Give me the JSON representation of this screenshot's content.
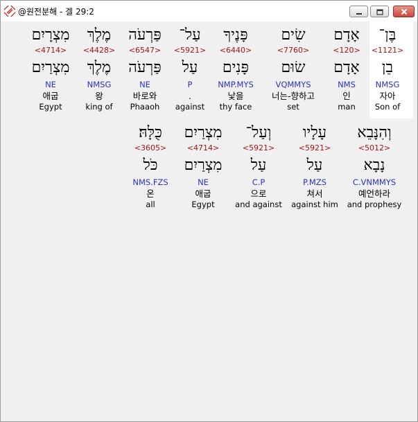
{
  "window": {
    "title": "@원전분해 - 겔 29:2"
  },
  "rows": [
    [
      {
        "hebrew": "בֶּן־",
        "strong": "<1121>",
        "lemma": "בֵן",
        "morph": "NMSG",
        "korean": "자아",
        "english": "Son of"
      },
      {
        "hebrew": "אָדָם",
        "strong": "<120>",
        "lemma": "אָדָם",
        "morph": "NMS",
        "korean": "인",
        "english": "man"
      },
      {
        "hebrew": "שִׂים",
        "strong": "<7760>",
        "lemma": "שׂוּם",
        "morph": "VQMMYS",
        "korean": "너는-향하고",
        "english": "set"
      },
      {
        "hebrew": "פָּנֶיךָ",
        "strong": "<6440>",
        "lemma": "פָּנִים",
        "morph": "NMP.MYS",
        "korean": "낯을",
        "english": "thy face"
      },
      {
        "hebrew": "עַל־",
        "strong": "<5921>",
        "lemma": "עַל",
        "morph": "P",
        "korean": ".",
        "english": "against"
      },
      {
        "hebrew": "פַּרְעֹה",
        "strong": "<6547>",
        "lemma": "פַּרְעֹה",
        "morph": "NE",
        "korean": "바로와",
        "english": "Phaaoh"
      },
      {
        "hebrew": "מֶלֶךְ",
        "strong": "<4428>",
        "lemma": "מֶלֶךְ",
        "morph": "NMSG",
        "korean": "왕",
        "english": "king of"
      },
      {
        "hebrew": "מִצְרָיִם",
        "strong": "<4714>",
        "lemma": "מִצְרַיִם",
        "morph": "NE",
        "korean": "애굽",
        "english": "Egypt"
      }
    ],
    [
      {
        "hebrew": "וְהִנָּבֵא",
        "strong": "<5012>",
        "lemma": "נָבָא",
        "morph": "C.VNMMYS",
        "korean": "예언하라",
        "english": "and prophesy"
      },
      {
        "hebrew": "עָלָיו",
        "strong": "<5921>",
        "lemma": "עַל",
        "morph": "P.MZS",
        "korean": "쳐서",
        "english": "against him"
      },
      {
        "hebrew": "וְעַל־",
        "strong": "<5921>",
        "lemma": "עַל",
        "morph": "C.P",
        "korean": "으로",
        "english": "and against"
      },
      {
        "hebrew": "מִצְרַיִם",
        "strong": "<4714>",
        "lemma": "מִצְרַיִם",
        "morph": "NE",
        "korean": "애굽",
        "english": "Egypt"
      },
      {
        "hebrew": "כֻּלָּהּ׃",
        "strong": "<3605>",
        "lemma": "כֹּל",
        "morph": "NMS.FZS",
        "korean": "온",
        "english": "all"
      }
    ]
  ]
}
